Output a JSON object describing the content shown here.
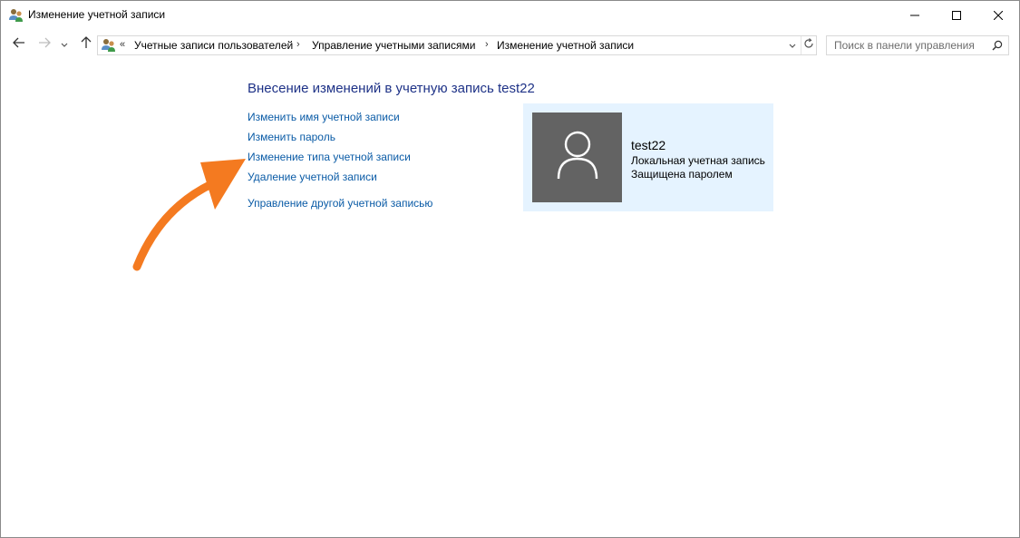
{
  "window": {
    "title": "Изменение учетной записи",
    "icon": "user-accounts-icon"
  },
  "titlebar": {
    "minimize_icon": "minimize-icon",
    "maximize_icon": "maximize-icon",
    "close_icon": "close-icon"
  },
  "navigation": {
    "back_icon": "arrow-left-icon",
    "forward_icon": "arrow-right-icon",
    "recent_icon": "chevron-down-icon",
    "up_icon": "arrow-up-icon"
  },
  "address": {
    "overflow": "«",
    "breadcrumbs": [
      "Учетные записи пользователей",
      "Управление учетными записями",
      "Изменение учетной записи"
    ],
    "separator": "›"
  },
  "search": {
    "placeholder": "Поиск в панели управления"
  },
  "content": {
    "heading": "Внесение изменений в учетную запись test22",
    "links": [
      "Изменить имя учетной записи",
      "Изменить пароль",
      "Изменение типа учетной записи",
      "Удаление учетной записи",
      "Управление другой учетной записью"
    ]
  },
  "account": {
    "name": "test22",
    "type": "Локальная учетная запись",
    "status": "Защищена паролем"
  },
  "colors": {
    "heading": "#1e3287",
    "link": "#0a5ba6",
    "panel_bg": "#e5f3ff",
    "avatar_bg": "#636363",
    "annotation_arrow": "#f47a20"
  }
}
